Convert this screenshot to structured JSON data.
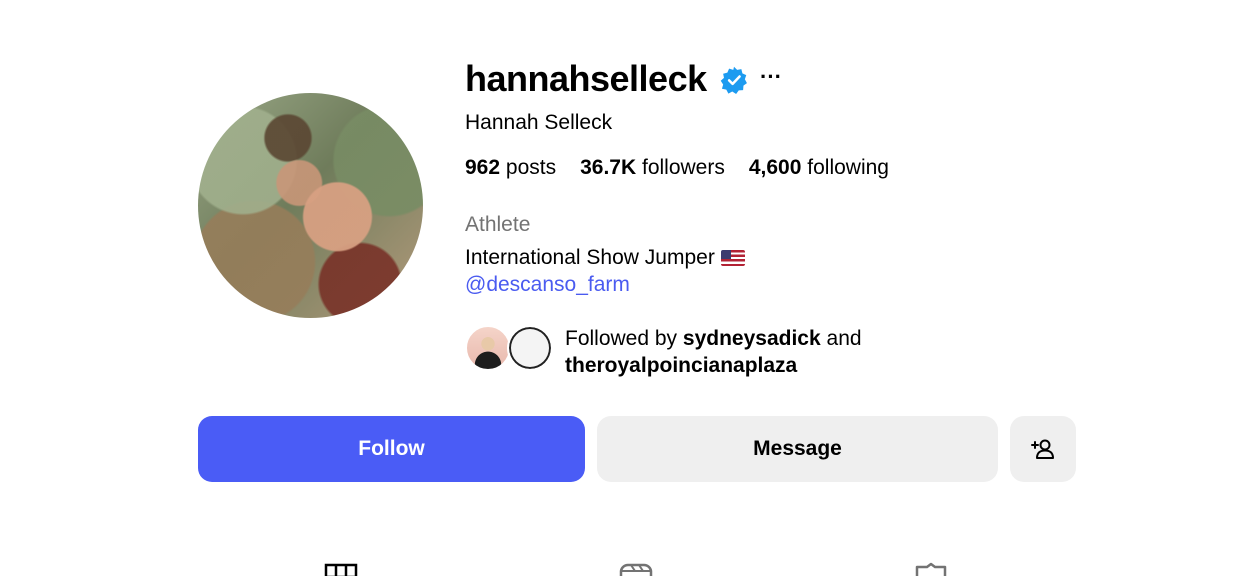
{
  "profile": {
    "username": "hannahselleck",
    "full_name": "Hannah Selleck",
    "verified": true,
    "more_label": "···"
  },
  "stats": {
    "posts_count": "962",
    "posts_label": "posts",
    "followers_count": "36.7K",
    "followers_label": "followers",
    "following_count": "4,600",
    "following_label": "following"
  },
  "bio": {
    "category": "Athlete",
    "text": "International Show Jumper",
    "link": "@descanso_farm"
  },
  "mutuals": {
    "prefix": "Followed by",
    "first": "sydneysadick",
    "joiner": "and",
    "second": "theroyalpoincianaplaza"
  },
  "actions": {
    "follow_label": "Follow",
    "message_label": "Message"
  },
  "tabs": [
    {
      "icon": "grid-icon"
    },
    {
      "icon": "reels-icon"
    },
    {
      "icon": "tagged-icon"
    }
  ],
  "colors": {
    "accent": "#4a5cf6",
    "link": "#4a5bf0",
    "verified": "#1d9bf0",
    "secondary_button": "#efefef",
    "muted_text": "#737373"
  }
}
